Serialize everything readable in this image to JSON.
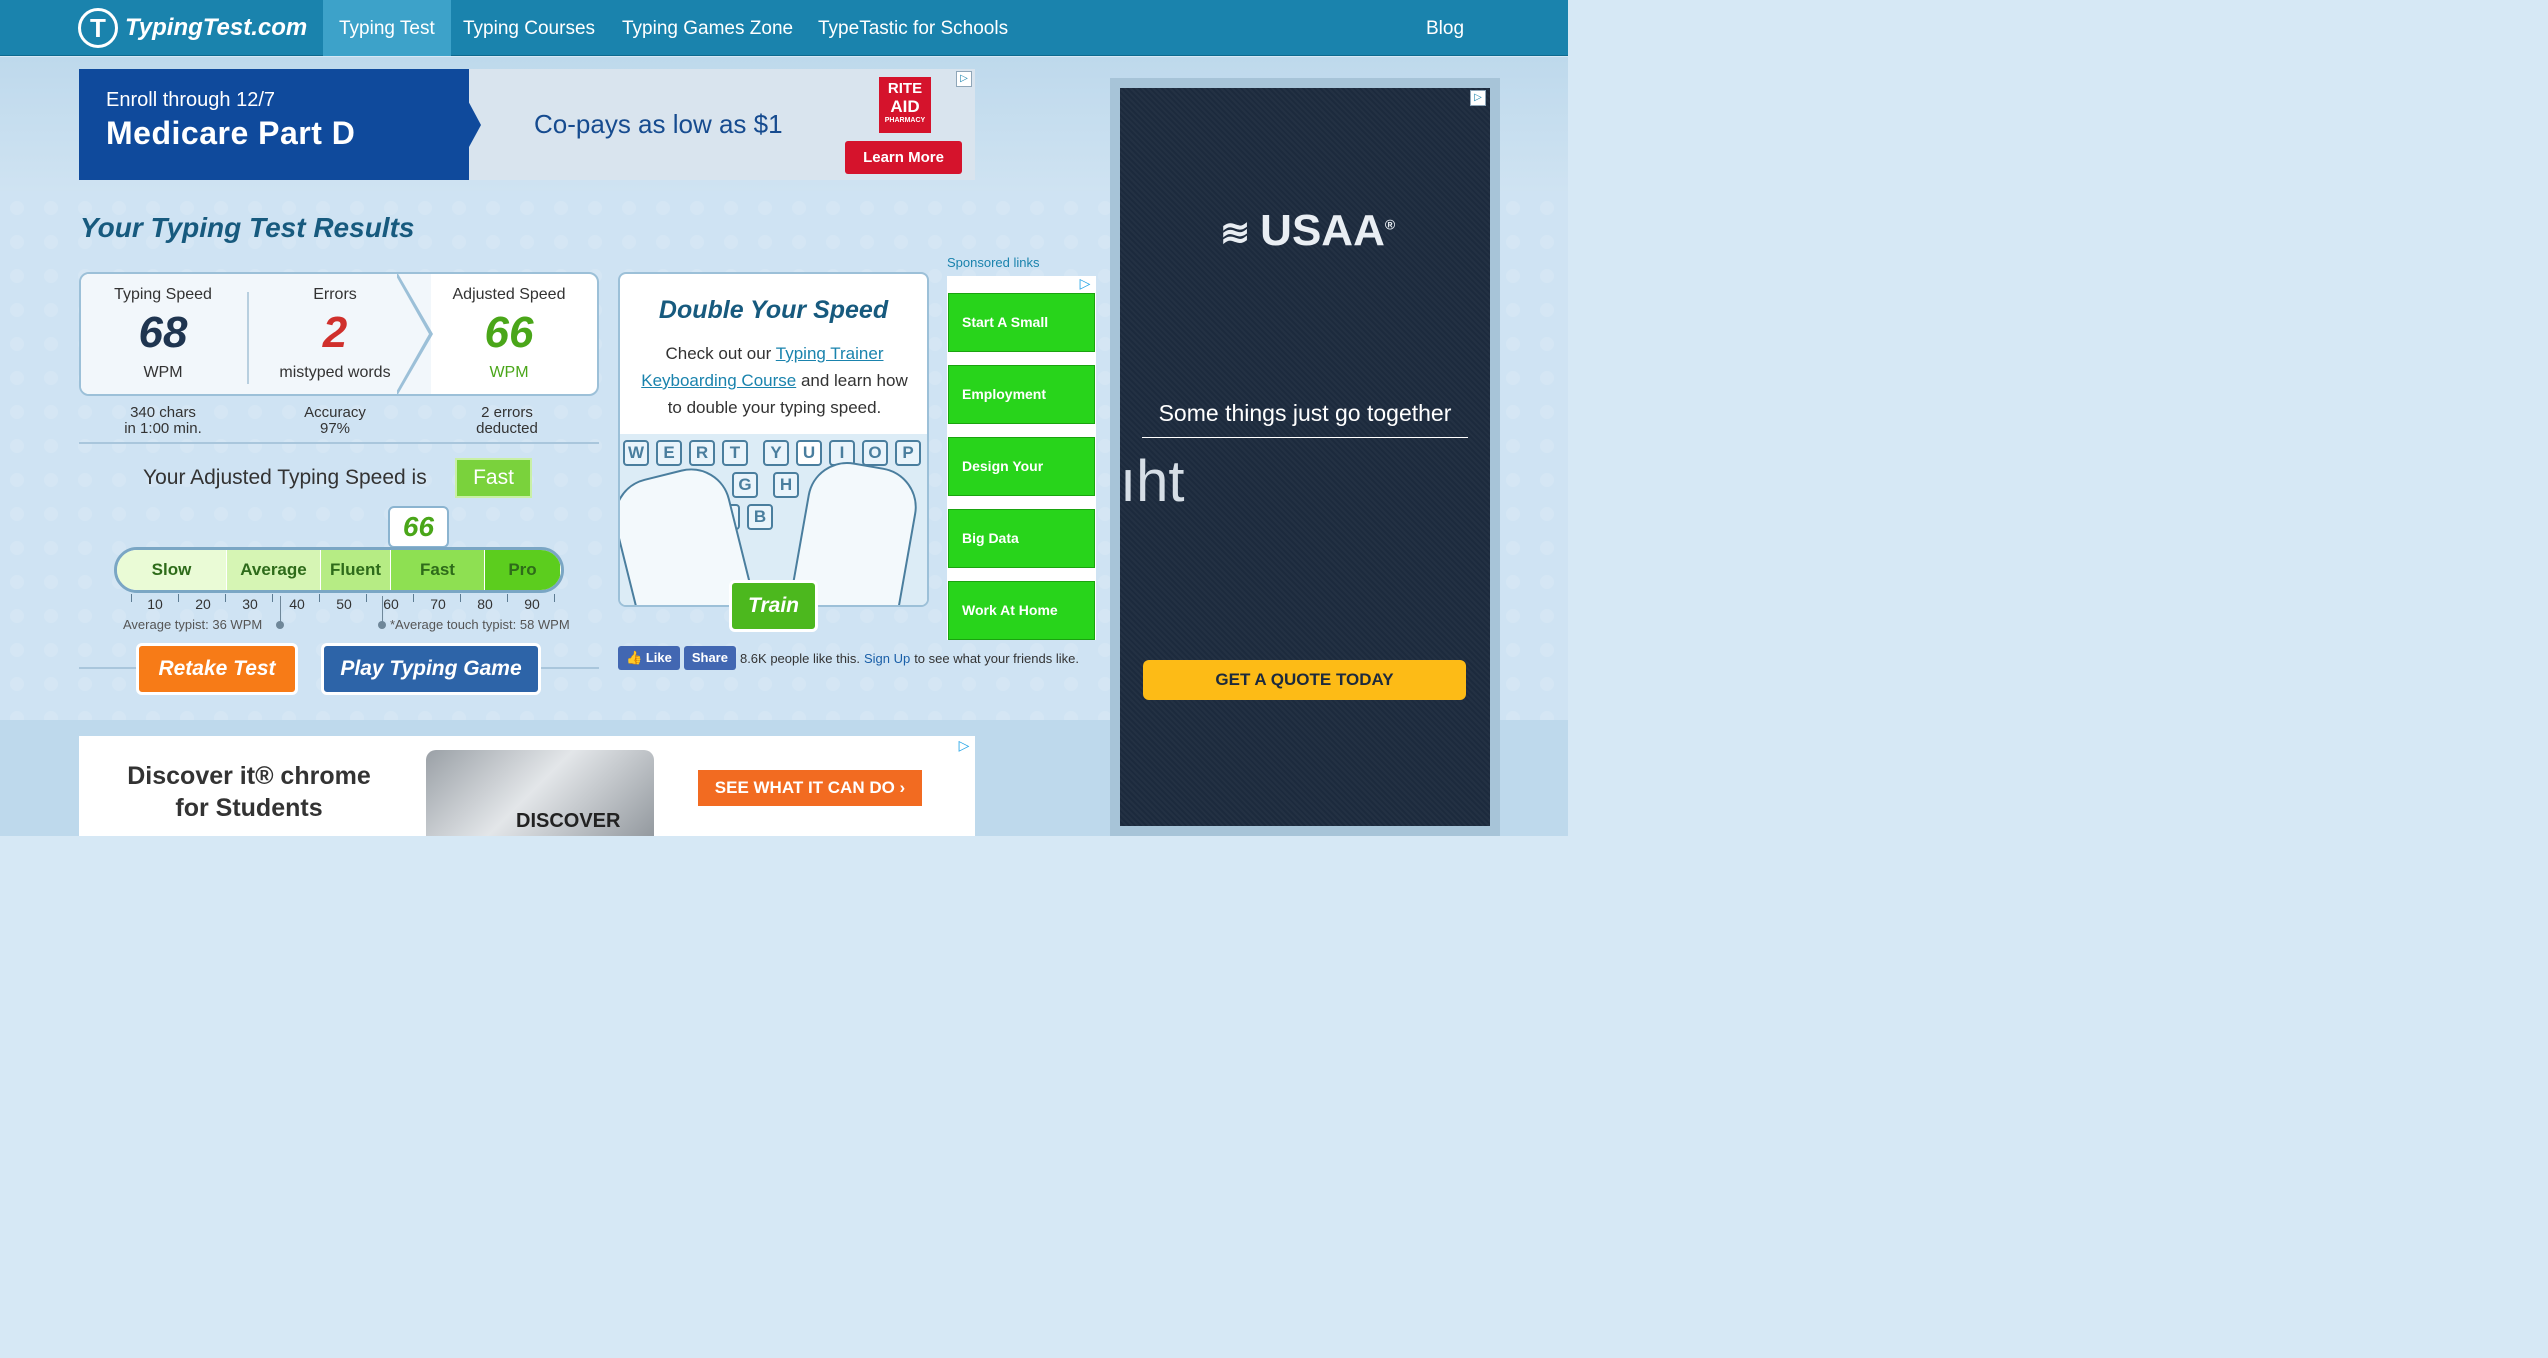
{
  "nav": {
    "logo": "TypingTest.com",
    "items": [
      "Typing Test",
      "Typing Courses",
      "Typing Games Zone",
      "TypeTastic for Schools"
    ],
    "blog": "Blog"
  },
  "ad_top": {
    "line1": "Enroll through 12/7",
    "line2": "Medicare Part D",
    "middle": "Co-pays as low as $1",
    "brand_l1": "RITE",
    "brand_l2": "AID",
    "brand_l3": "PHARMACY",
    "button": "Learn More"
  },
  "results": {
    "title": "Your Typing Test Results",
    "speed_label": "Typing Speed",
    "speed_value": "68",
    "speed_unit": "WPM",
    "errors_label": "Errors",
    "errors_value": "2",
    "errors_unit": "mistyped words",
    "adjusted_label": "Adjusted Speed",
    "adjusted_value": "66",
    "adjusted_unit": "WPM",
    "chars_l1": "340 chars",
    "chars_l2": "in 1:00 min.",
    "acc_l1": "Accuracy",
    "acc_l2": "97%",
    "ded_l1": "2 errors",
    "ded_l2": "deducted",
    "speed_sentence": "Your Adjusted Typing Speed is",
    "speed_class": "Fast",
    "score_bubble": "66"
  },
  "gauge": {
    "segments": [
      "Slow",
      "Average",
      "Fluent",
      "Fast",
      "Pro"
    ],
    "ticks": [
      "10",
      "20",
      "30",
      "40",
      "50",
      "60",
      "70",
      "80",
      "90"
    ],
    "avg_typist": "Average typist: 36 WPM",
    "avg_touch": "*Average touch typist: 58 WPM"
  },
  "buttons": {
    "retake": "Retake Test",
    "game": "Play Typing Game",
    "train": "Train"
  },
  "promo": {
    "title": "Double Your Speed",
    "pre": "Check out our ",
    "link1": "Typing Trainer",
    "link2": "Keyboarding Course",
    "post": " and learn how to double your typing speed.",
    "keys_row1": [
      "W",
      "E",
      "R",
      "T",
      "Y",
      "U",
      "I",
      "O",
      "P"
    ],
    "keys_row2": [
      "G",
      "H"
    ],
    "keys_row3": [
      "V",
      "B"
    ]
  },
  "facebook": {
    "like": "Like",
    "share": "Share",
    "count_text": "8.6K people like this.",
    "signup": "Sign Up",
    "after": "to see what your friends like."
  },
  "sponsored": {
    "label": "Sponsored links",
    "links": [
      "Start A Small",
      "Employment",
      "Design Your",
      "Big Data",
      "Work At Home"
    ]
  },
  "ad_right": {
    "brand": "USAA",
    "reg": "®",
    "tagline": "Some things just go together",
    "fragment": "ıht",
    "cta": "GET A QUOTE TODAY"
  },
  "ad_bottom": {
    "title_l1": "Discover it® chrome",
    "title_l2": "for Students",
    "card_text": "DISCOVER",
    "button": "SEE WHAT IT CAN DO ›"
  },
  "colors": {
    "nav_bg": "#1a83ad",
    "title_blue": "#175a7e",
    "error_red": "#d0302c",
    "good_green": "#4aa619",
    "retake_orange": "#f77b17",
    "game_blue": "#2d64a8",
    "sponsored_green": "#28d41b"
  }
}
